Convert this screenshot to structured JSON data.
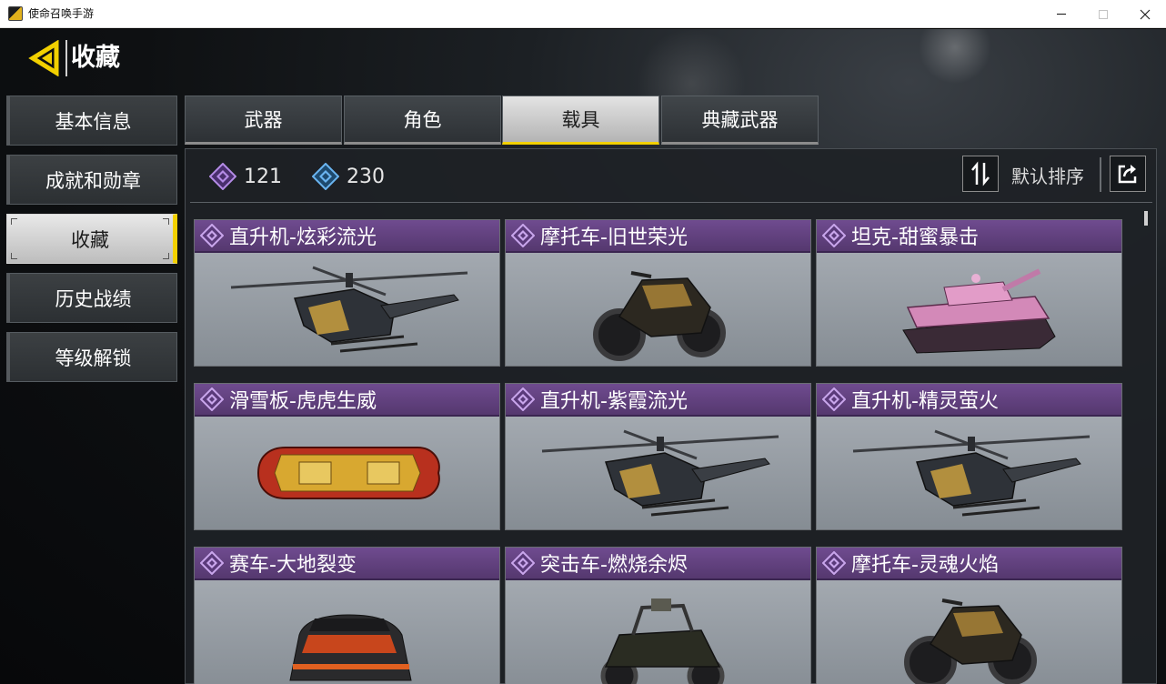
{
  "window": {
    "title": "使命召唤手游"
  },
  "header": {
    "title": "收藏"
  },
  "sidebar": {
    "items": [
      {
        "label": "基本信息"
      },
      {
        "label": "成就和勋章"
      },
      {
        "label": "收藏",
        "active": true
      },
      {
        "label": "历史战绩"
      },
      {
        "label": "等级解锁"
      }
    ]
  },
  "tabs": [
    {
      "label": "武器"
    },
    {
      "label": "角色"
    },
    {
      "label": "载具",
      "active": true
    },
    {
      "label": "典藏武器"
    }
  ],
  "currencies": [
    {
      "amount": "121",
      "color": "#b48be6"
    },
    {
      "amount": "230",
      "color": "#6ab4f0"
    }
  ],
  "sort": {
    "label": "默认排序"
  },
  "colors": {
    "accent": "#f2d000",
    "card_header": "#6f4b8f"
  },
  "vehicles": [
    {
      "name": "直升机-炫彩流光",
      "icon": "helicopter"
    },
    {
      "name": "摩托车-旧世荣光",
      "icon": "motorcycle"
    },
    {
      "name": "坦克-甜蜜暴击",
      "icon": "tank"
    },
    {
      "name": "滑雪板-虎虎生威",
      "icon": "snowboard"
    },
    {
      "name": "直升机-紫霞流光",
      "icon": "helicopter"
    },
    {
      "name": "直升机-精灵萤火",
      "icon": "helicopter"
    },
    {
      "name": "赛车-大地裂变",
      "icon": "race-car"
    },
    {
      "name": "突击车-燃烧余烬",
      "icon": "assault-buggy"
    },
    {
      "name": "摩托车-灵魂火焰",
      "icon": "motorcycle"
    }
  ]
}
